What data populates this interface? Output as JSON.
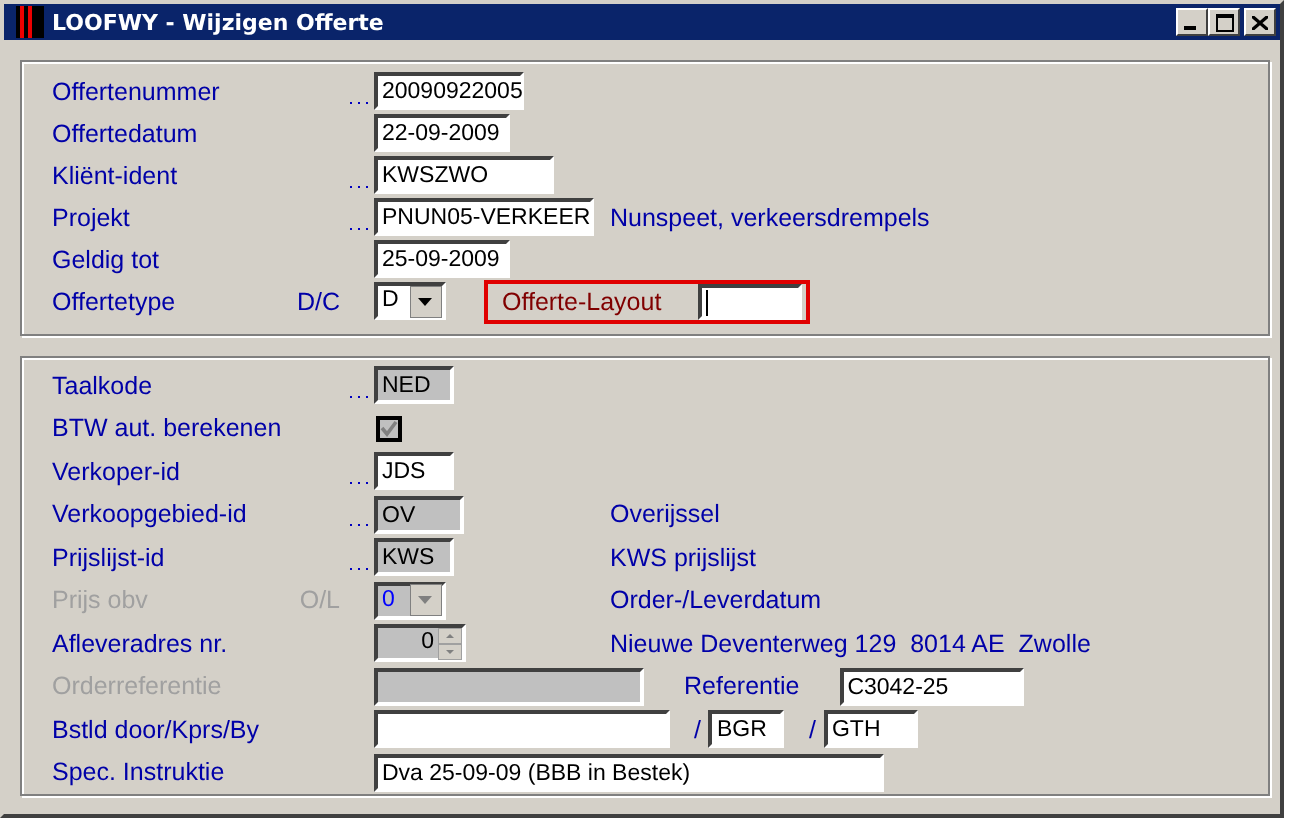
{
  "window": {
    "title": "LOOFWY - Wijzigen Offerte"
  },
  "header_panel": {
    "rows": [
      {
        "label": "Offertenummer",
        "lookup": true,
        "kind": "text",
        "value": "20090922005",
        "readonly": false
      },
      {
        "label": "Offertedatum",
        "lookup": false,
        "kind": "text",
        "value": "22-09-2009",
        "readonly": false
      },
      {
        "label": "Kliënt-ident",
        "lookup": true,
        "kind": "text",
        "value": "KWSZWO",
        "readonly": false
      },
      {
        "label": "Projekt",
        "lookup": true,
        "kind": "text",
        "value": "PNUN05-VERKEER",
        "readonly": false,
        "note": "Nunspeet, verkeersdrempels"
      },
      {
        "label": "Geldig tot",
        "lookup": false,
        "kind": "text",
        "value": "25-09-2009",
        "readonly": false
      },
      {
        "label": "Offertetype",
        "code": "D/C",
        "lookup": false,
        "kind": "select",
        "value": "D",
        "disabled": false,
        "layout": {
          "label": "Offerte-Layout",
          "highlighted": true,
          "focused": true
        }
      }
    ]
  },
  "detail_panel": {
    "rows": [
      {
        "label": "Taalkode",
        "lookup": true,
        "kind": "text",
        "value": "NED",
        "readonly": true
      },
      {
        "label": "BTW aut. berekenen",
        "lookup": false,
        "kind": "checkbox",
        "checked": true,
        "disabled": true
      },
      {
        "label": "Verkoper-id",
        "lookup": true,
        "kind": "text",
        "value": "JDS",
        "readonly": false
      },
      {
        "label": "Verkoopgebied-id",
        "lookup": true,
        "kind": "text",
        "value": "OV",
        "readonly": true,
        "note": "Overijssel"
      },
      {
        "label": "Prijslijst-id",
        "lookup": true,
        "kind": "text",
        "value": "KWS",
        "readonly": true,
        "note": "KWS prijslijst"
      },
      {
        "label": "Prijs obv",
        "label_disabled": true,
        "code": "O/L",
        "lookup": false,
        "kind": "select",
        "value": "0",
        "disabled": true,
        "note": "Order-/Leverdatum"
      },
      {
        "label": "Afleveradres nr.",
        "lookup": false,
        "kind": "spin",
        "value": "0",
        "readonly": true,
        "note": "Nieuwe Deventerweg 129  8014 AE  Zwolle"
      },
      {
        "label": "Orderreferentie",
        "label_disabled": true,
        "lookup": false,
        "kind": "text",
        "readonly": true,
        "after": [
          {
            "kind": "label",
            "text": "Referentie"
          },
          {
            "kind": "field",
            "value": "C3042-25"
          }
        ]
      },
      {
        "label": "Bstld door/Kprs/By",
        "lookup": false,
        "kind": "text",
        "readonly": false,
        "after": [
          {
            "kind": "separator",
            "text": "/"
          },
          {
            "kind": "field",
            "value": "BGR"
          },
          {
            "kind": "separator",
            "text": "/"
          },
          {
            "kind": "field",
            "value": "GTH"
          }
        ]
      },
      {
        "label": "Spec. Instruktie",
        "lookup": false,
        "kind": "text",
        "value": "Dva 25-09-09 (BBB in Bestek)",
        "readonly": false
      }
    ]
  }
}
